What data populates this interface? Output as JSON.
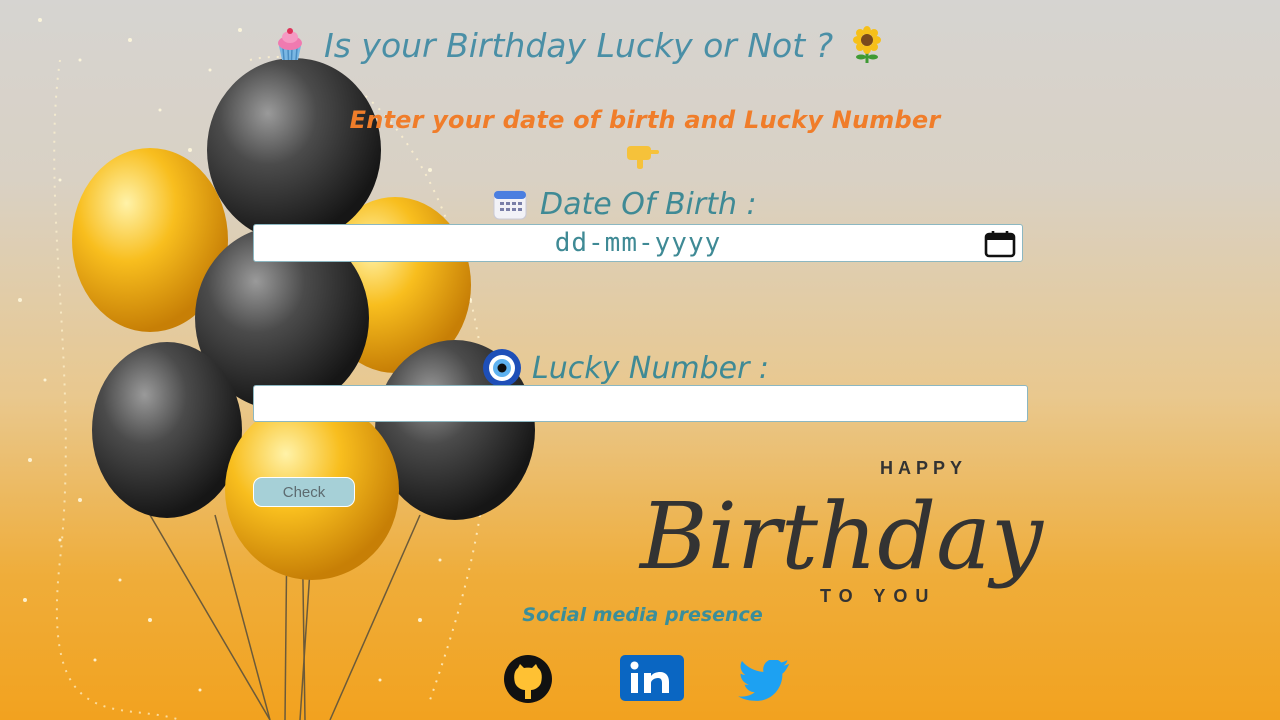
{
  "header": {
    "title": "Is your Birthday Lucky or Not ?",
    "left_icon": "cupcake-icon",
    "right_icon": "sunflower-icon"
  },
  "instructions": {
    "text": "Enter your date of birth and Lucky Number",
    "icon": "pointing-down-hand-icon"
  },
  "form": {
    "dob_label": "Date Of Birth :",
    "dob_icon": "calendar-icon",
    "dob_placeholder": "dd-mm-yyyy",
    "lucky_label": "Lucky Number :",
    "lucky_icon": "evil-eye-icon",
    "lucky_value": "",
    "check_label": "Check"
  },
  "banner": {
    "happy": "HAPPY",
    "birthday": "Birthday",
    "to_you": "TO YOU"
  },
  "social": {
    "label": "Social media presence",
    "items": [
      "github-icon",
      "linkedin-icon",
      "twitter-icon"
    ]
  },
  "colors": {
    "title": "#4a8fa6",
    "subtitle": "#f07d2a",
    "label": "#3f8a95",
    "button": "#a6d0d7",
    "gold": "#f2a21f"
  }
}
